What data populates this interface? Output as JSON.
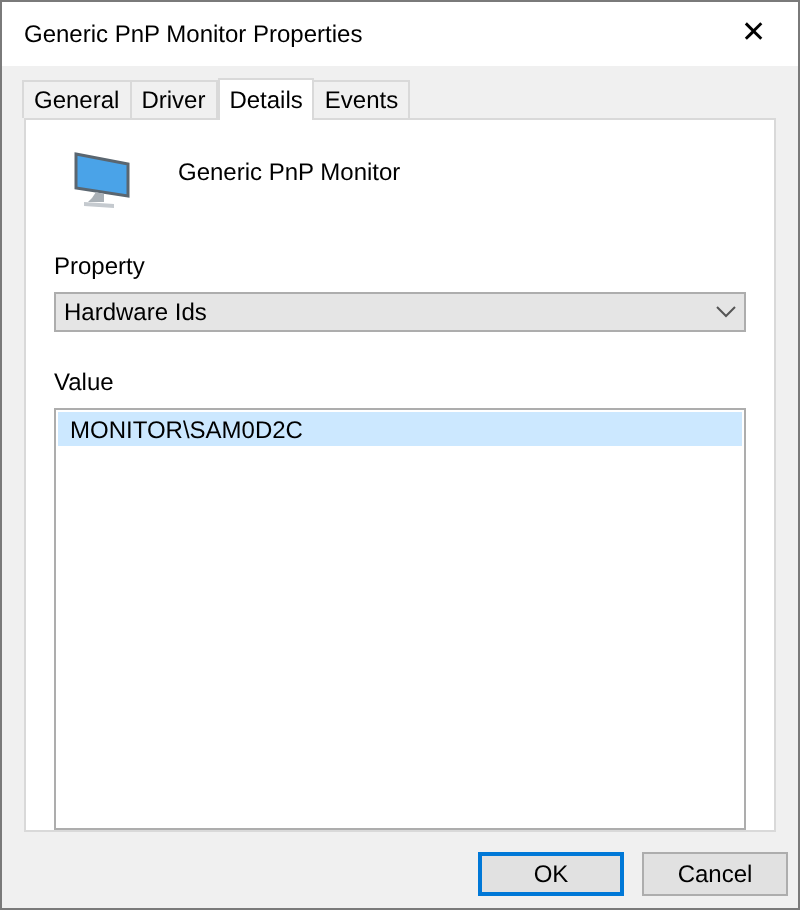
{
  "window": {
    "title": "Generic PnP Monitor Properties",
    "close": "✕"
  },
  "tabs": [
    {
      "label": "General",
      "selected": false
    },
    {
      "label": "Driver",
      "selected": false
    },
    {
      "label": "Details",
      "selected": true
    },
    {
      "label": "Events",
      "selected": false
    }
  ],
  "device": {
    "name": "Generic PnP Monitor"
  },
  "property": {
    "label": "Property",
    "value": "Hardware Ids"
  },
  "value": {
    "label": "Value",
    "items": [
      {
        "text": "MONITOR\\SAM0D2C",
        "selected": true
      }
    ]
  },
  "buttons": [
    {
      "label": "OK",
      "default": true
    },
    {
      "label": "Cancel",
      "default": false
    }
  ]
}
